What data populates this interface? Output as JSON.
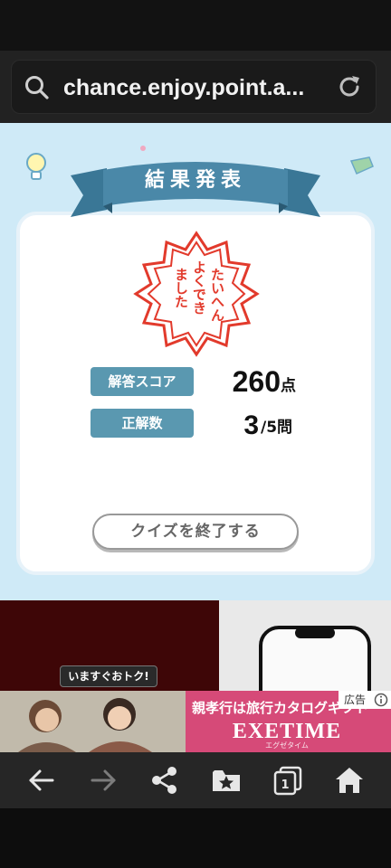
{
  "browser": {
    "url": "chance.enjoy.point.a..."
  },
  "quiz": {
    "ribbon_title": "結果発表",
    "stamp_lines": [
      "たいへん",
      "よくでき",
      "ました"
    ],
    "score_label": "解答スコア",
    "score_value": "260",
    "score_unit": "点",
    "correct_label": "正解数",
    "correct_value": "3",
    "correct_total": "/5問",
    "end_button": "クイズを終了する"
  },
  "promo": {
    "badge": "いますぐおトク!"
  },
  "ad": {
    "headline": "親孝行は旅行カタログギフト",
    "brand": "EXETIME",
    "brand_sub": "エグゼタイム",
    "label": "広告"
  },
  "nav": {
    "icons": [
      "back-arrow-icon",
      "forward-arrow-icon",
      "share-icon",
      "bookmark-star-icon",
      "tabs-icon",
      "home-icon"
    ],
    "tab_count": "1"
  },
  "colors": {
    "quiz_bg": "#cfeaf7",
    "ribbon": "#4a88a8",
    "badge": "#5a98b0",
    "stamp_red": "#e23a2c",
    "ad_pink": "#d64a78"
  }
}
